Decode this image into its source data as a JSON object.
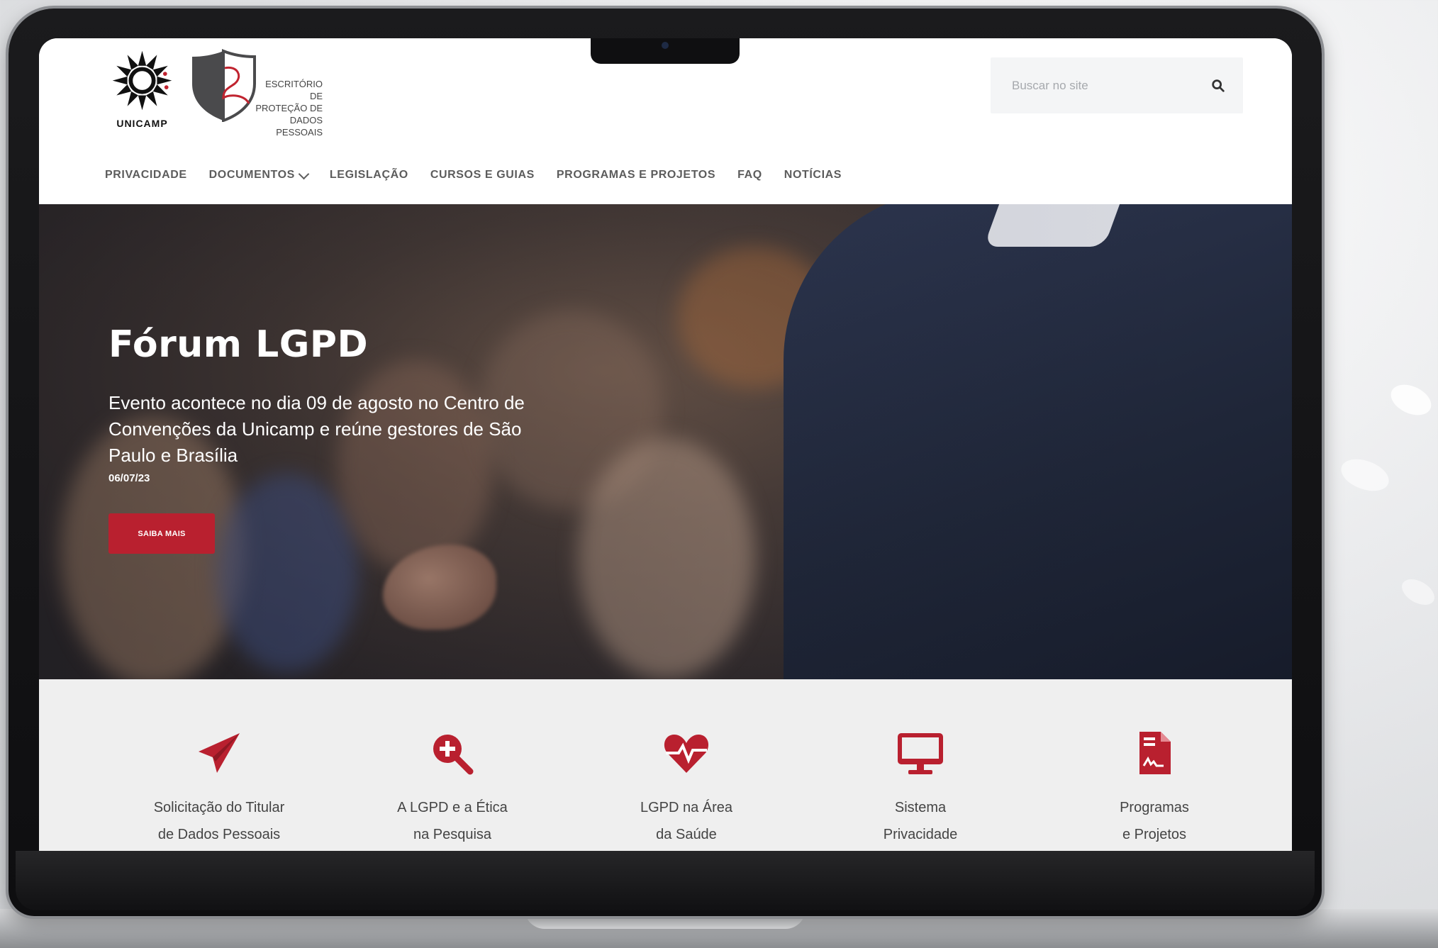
{
  "header": {
    "logo_unicamp_text": "UNICAMP",
    "logo_epdp_lines": [
      "ESCRITÓRIO DE",
      "PROTEÇÃO DE",
      "DADOS PESSOAIS"
    ],
    "search": {
      "placeholder": "Buscar no site",
      "value": ""
    }
  },
  "nav": {
    "items": [
      {
        "label": "PRIVACIDADE"
      },
      {
        "label": "DOCUMENTOS"
      },
      {
        "label": "LEGISLAÇÃO"
      },
      {
        "label": "CURSOS E GUIAS"
      },
      {
        "label": "PROGRAMAS E PROJETOS"
      },
      {
        "label": "FAQ"
      },
      {
        "label": "NOTÍCIAS"
      }
    ]
  },
  "hero": {
    "title": "Fórum LGPD",
    "description": "Evento acontece no dia 09 de agosto no Centro de Convenções da Unicamp e reúne gestores de São Paulo e Brasília",
    "date": "06/07/23",
    "button_label": "SAIBA MAIS",
    "slides_total": 5,
    "active_slide": 1
  },
  "quick_links": [
    {
      "line1": "Solicitação do Titular",
      "line2": "de Dados Pessoais",
      "icon": "paper-plane-icon"
    },
    {
      "line1": "A LGPD e a Ética",
      "line2": "na Pesquisa",
      "icon": "zoom-plus-icon"
    },
    {
      "line1": "LGPD na Área",
      "line2": "da Saúde",
      "icon": "heartbeat-icon"
    },
    {
      "line1": "Sistema",
      "line2": "Privacidade",
      "icon": "monitor-icon"
    },
    {
      "line1": "Programas",
      "line2": "e Projetos",
      "icon": "document-signature-icon"
    }
  ],
  "colors": {
    "accent": "#b9202f",
    "nav_text": "#5c5c5c",
    "quick_bg": "#efefef"
  }
}
